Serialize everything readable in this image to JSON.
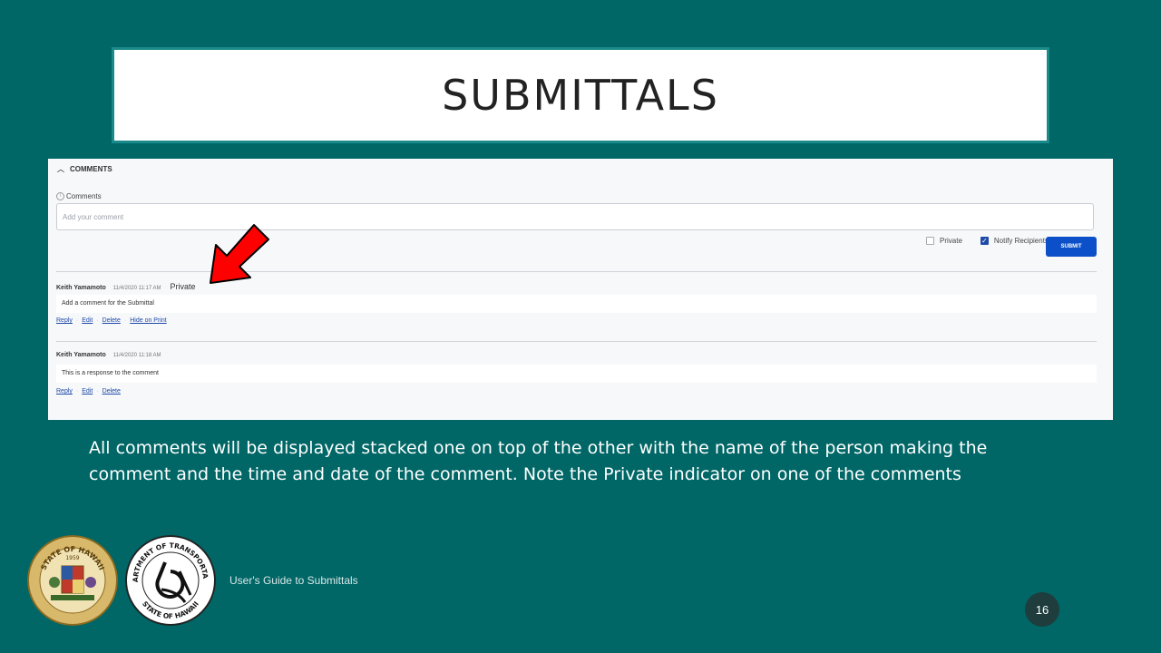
{
  "slide": {
    "title": "SUBMITTALS",
    "caption": "All comments will be displayed stacked one on top of the other with the name of the person making the comment and the time and date of the comment.  Note the Private indicator on one of the comments",
    "footer": "User's Guide to Submittals",
    "page_number": "16"
  },
  "comments_panel": {
    "section_title": "COMMENTS",
    "field_label": "Comments",
    "placeholder": "Add your comment",
    "private_label": "Private",
    "private_checked": false,
    "notify_label": "Notify Recipients",
    "notify_checked": true,
    "submit_label": "SUBMIT",
    "items": [
      {
        "author": "Keith Yamamoto",
        "time": "11/4/2020 11:17 AM",
        "private_tag": "Private",
        "text": "Add a comment for the Submittal",
        "actions": [
          "Reply",
          "Edit",
          "Delete",
          "Hide on Print"
        ]
      },
      {
        "author": "Keith Yamamoto",
        "time": "11/4/2020 11:18 AM",
        "text": "This is a response to the comment",
        "actions": [
          "Reply",
          "Edit",
          "Delete"
        ]
      }
    ]
  },
  "logos": {
    "seal_ring_text": "STATE OF HAWAII",
    "seal_year": "1959",
    "dot_ring_top": "DEPARTMENT OF TRANSPORTATION",
    "dot_ring_bottom": "STATE OF HAWAII"
  },
  "colors": {
    "background": "#006666",
    "accent_blue": "#0b50c8",
    "arrow_red": "#ff0000"
  },
  "icons": [
    "chevron-up-icon",
    "info-icon",
    "checkbox-icon",
    "arrow-pointer-icon"
  ]
}
